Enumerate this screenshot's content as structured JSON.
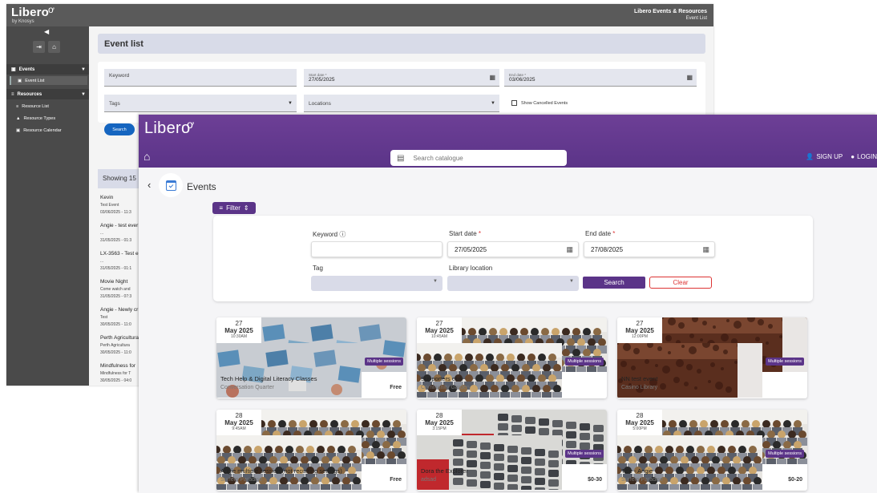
{
  "admin": {
    "brand": "Libero",
    "brand_sub": "by Knosys",
    "app_title": "Libero Events & Resources",
    "app_sub": "Event List",
    "collapse_glyph": "◀",
    "sidebar": {
      "groups": [
        {
          "label": "Events",
          "icon": "calendar-icon"
        },
        {
          "label": "Resources",
          "icon": "list-icon"
        }
      ],
      "items": [
        {
          "label": "Event List"
        },
        {
          "label": "Resource List"
        },
        {
          "label": "Resource Types"
        },
        {
          "label": "Resource Calendar"
        }
      ]
    },
    "page_title": "Event list",
    "filters": {
      "keyword_placeholder": "Keyword",
      "start_label": "Start date *",
      "start_value": "27/05/2025",
      "end_label": "End date *",
      "end_value": "03/06/2025",
      "tags_label": "Tags",
      "locations_label": "Locations",
      "show_cancelled": "Show Cancelled Events"
    },
    "search_label": "Search",
    "showing": "Showing 15",
    "events": [
      {
        "title": "Kevin",
        "sub": "Test Event",
        "date": "03/06/2025 - 11:3"
      },
      {
        "title": "Angie - test ever",
        "sub": "...",
        "date": "31/05/2025 - 01:3"
      },
      {
        "title": "LX-3563 - Test e",
        "sub": "...",
        "date": "31/05/2025 - 01:1"
      },
      {
        "title": "Movie Night",
        "sub": "Come watch and",
        "date": "31/05/2025 - 07:3"
      },
      {
        "title": "Angie - Newly cr",
        "sub": "Test",
        "date": "30/05/2025 - 11:0"
      },
      {
        "title": "Perth Agricultura",
        "sub": "Perth Agricultura",
        "date": "30/05/2025 - 11:0"
      },
      {
        "title": "Mindfulness for",
        "sub": "Mindfulness for T",
        "date": "30/05/2025 - 04:0"
      }
    ]
  },
  "public": {
    "brand": "Libero",
    "search_placeholder": "Search catalogue",
    "sign_up": "SIGN UP",
    "login": "LOGIN",
    "page_title": "Events",
    "filter_label": "Filter",
    "keyword_label": "Keyword",
    "start_label": "Start date",
    "start_value": "27/05/2025",
    "end_label": "End date",
    "end_value": "27/08/2025",
    "tag_label": "Tag",
    "location_label": "Library location",
    "required_mark": "*",
    "search_btn": "Search",
    "clear_btn": "Clear",
    "multi_label": "Multiple sessions",
    "cards": [
      {
        "day": "27",
        "month_year": "May 2025",
        "time": "10:30AM",
        "title": "Tech Help & Digital Literacy Classes",
        "venue": "Conversation Quarter",
        "price": "Free",
        "image": "laptops"
      },
      {
        "day": "27",
        "month_year": "May 2025",
        "time": "10:45AM",
        "title": "Supporters club",
        "venue": "Community Garden",
        "price": "",
        "image": "audience"
      },
      {
        "day": "27",
        "month_year": "May 2025",
        "time": "12:00PM",
        "title": "NN test event",
        "venue": "Casino Library",
        "price": "",
        "image": "cake"
      },
      {
        "day": "28",
        "month_year": "May 2025",
        "time": "9:45AM",
        "title": "Angie multiple session (not recurring settings)",
        "venue": "Surfers Paradise",
        "price": "Free",
        "image": "audience"
      },
      {
        "day": "28",
        "month_year": "May 2025",
        "time": "3:15PM",
        "title": "Dora the Explorer",
        "venue": "adsad",
        "price": "$0-30",
        "image": "calculator"
      },
      {
        "day": "28",
        "month_year": "May 2025",
        "time": "5:00PM",
        "title": "Title - Angie",
        "venue": "Surfers Paradise",
        "price": "$0-20",
        "image": "audience"
      }
    ],
    "colors": {
      "brand": "#5b3488",
      "clear": "#d33333"
    }
  }
}
